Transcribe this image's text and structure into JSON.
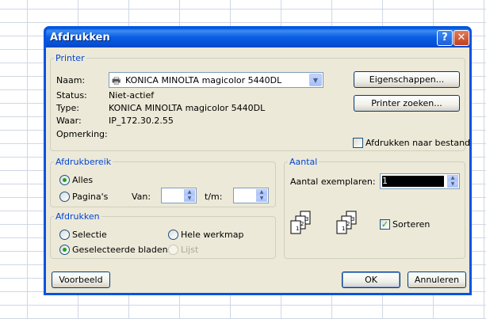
{
  "window": {
    "title": "Afdrukken"
  },
  "printer": {
    "legend": "Printer",
    "name_label": "Naam:",
    "name_value": "KONICA MINOLTA magicolor 5440DL",
    "status_label": "Status:",
    "status_value": "Niet-actief",
    "type_label": "Type:",
    "type_value": "KONICA MINOLTA magicolor 5440DL",
    "where_label": "Waar:",
    "where_value": "IP_172.30.2.55",
    "comment_label": "Opmerking:",
    "comment_value": "",
    "properties_button": "Eigenschappen...",
    "find_printer_button": "Printer zoeken...",
    "print_to_file_label": "Afdrukken naar bestand",
    "print_to_file_checked": false
  },
  "range": {
    "legend": "Afdrukbereik",
    "all_label": "Alles",
    "pages_label": "Pagina's",
    "from_label": "Van:",
    "to_label": "t/m:",
    "from_value": "",
    "to_value": "",
    "selected": "all"
  },
  "print_what": {
    "legend": "Afdrukken",
    "selection_label": "Selectie",
    "active_sheets_label": "Geselecteerde bladen",
    "entire_workbook_label": "Hele werkmap",
    "list_label": "Lijst",
    "selected": "active_sheets"
  },
  "copies": {
    "legend": "Aantal",
    "count_label": "Aantal exemplaren:",
    "count_value": "1",
    "collate_label": "Sorteren",
    "collate_checked": true
  },
  "footer": {
    "preview_button": "Voorbeeld",
    "ok_button": "OK",
    "cancel_button": "Annuleren"
  }
}
